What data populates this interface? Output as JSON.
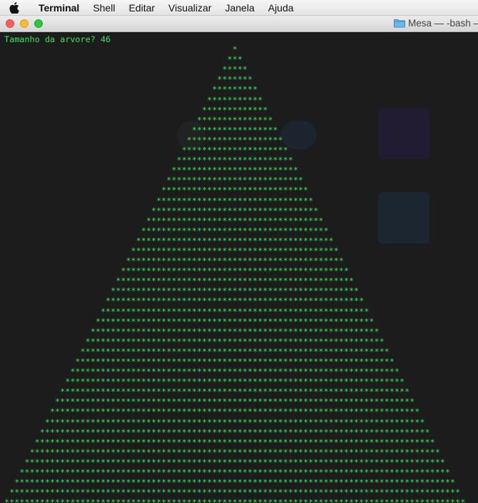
{
  "menubar": {
    "app_name": "Terminal",
    "items": [
      "Shell",
      "Editar",
      "Visualizar",
      "Janela",
      "Ajuda"
    ]
  },
  "window": {
    "title": "Mesa — -bash —",
    "title_icon": "folder-icon"
  },
  "terminal": {
    "prompt_line": "Tamanho da arvore? 46",
    "tree_char": "*",
    "tree_size": 46,
    "text_color": "#37e65a",
    "background": "#1c1c1c"
  }
}
